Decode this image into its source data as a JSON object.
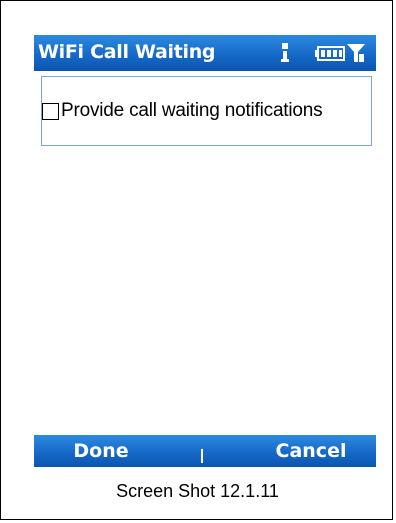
{
  "title_bar": {
    "title": "WiFi Call Waiting",
    "icons": [
      "signal-strength-icon",
      "battery-icon",
      "antenna-icon"
    ]
  },
  "options": [
    {
      "label": "Provide call waiting notifications",
      "checked": false
    }
  ],
  "softkeys": {
    "left_label": "Done",
    "right_label": "Cancel"
  },
  "caption": "Screen Shot 12.1.11",
  "colors": {
    "titlebar_blue": "#1669c8",
    "content_border": "#7aa7d6"
  }
}
